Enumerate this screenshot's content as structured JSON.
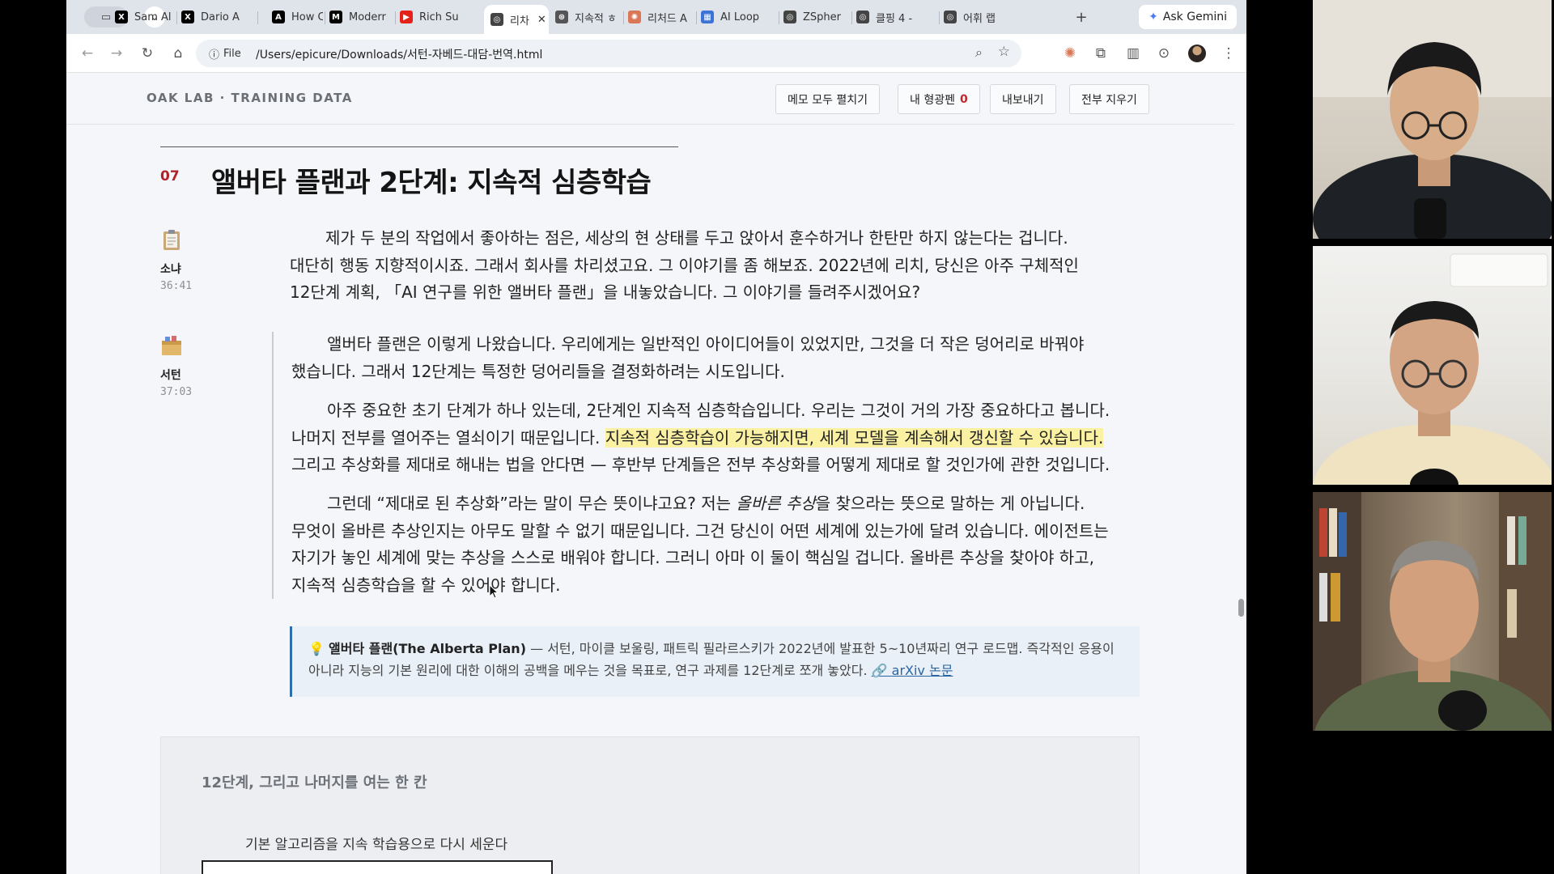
{
  "browser": {
    "tabs": [
      {
        "title": "Sam Al",
        "icon": "x-logo-icon",
        "color": "#000000"
      },
      {
        "title": "Dario A",
        "icon": "x-logo-icon",
        "color": "#000000"
      },
      {
        "title": "How Cl",
        "icon": "anthropic-logo-icon",
        "color": "#000000"
      },
      {
        "title": "Moderr",
        "icon": "medium-logo-icon",
        "color": "#000000"
      },
      {
        "title": "Rich Su",
        "icon": "youtube-icon",
        "color": "#e62117"
      },
      {
        "title": "리차",
        "icon": "globe-icon",
        "color": "#444444",
        "active": true
      },
      {
        "title": "지속적 ㅎ",
        "icon": "chatgpt-icon",
        "color": "#555555"
      },
      {
        "title": "리처드 A",
        "icon": "claude-icon",
        "color": "#d97757"
      },
      {
        "title": "AI Loop",
        "icon": "grid-icon",
        "color": "#3b74d6"
      },
      {
        "title": "ZSpher",
        "icon": "globe-icon",
        "color": "#444444"
      },
      {
        "title": "클핑 4 -",
        "icon": "globe-icon",
        "color": "#444444"
      },
      {
        "title": "어휘 랩",
        "icon": "globe-icon",
        "color": "#444444"
      }
    ],
    "ask_gemini": "Ask Gemini",
    "info_label": "File",
    "url": "/Users/epicure/Downloads/서턴-자베드-대담-번역.html"
  },
  "site": {
    "brand": "OAK LAB · TRAINING DATA",
    "buttons": {
      "expand_memos": "메모 모두 펼치기",
      "my_highlighter": "내 형광펜",
      "highlight_count": "0",
      "export": "내보내기",
      "clear_all": "전부 지우기"
    }
  },
  "section": {
    "number": "07",
    "title": "앨버타 플랜과 2단계: 지속적 심층학습",
    "speakers": [
      {
        "name": "소냐",
        "time": "36:41",
        "icon": "clipboard-icon"
      },
      {
        "name": "서턴",
        "time": "37:03",
        "icon": "box-icon"
      }
    ],
    "q_lines": [
      "제가 두 분의 작업에서 좋아하는 점은, 세상의 현 상태를 두고 앉아서 훈수하거나 한탄만 하지 않는다는 겁니다.",
      "대단히 행동 지향적이시죠. 그래서 회사를 차리셨고요. 그 이야기를 좀 해보죠. 2022년에 리치, 당신은 아주 구체적인",
      "12단계 계획, 「AI 연구를 위한 앨버타 플랜」을 내놓았습니다. 그 이야기를 들려주시겠어요?"
    ],
    "a1_lines": [
      "앨버타 플랜은 이렇게 나왔습니다. 우리에게는 일반적인 아이디어들이 있었지만, 그것을 더 작은 덩어리로 바꿔야",
      "했습니다. 그래서 12단계는 특정한 덩어리들을 결정화하려는 시도입니다."
    ],
    "a2_line1": "아주 중요한 초기 단계가 하나 있는데, 2단계인 지속적 심층학습입니다. 우리는 그것이 거의 가장 중요하다고 봅니다.",
    "a2_line2_pre": "나머지 전부를 열어주는 열쇠이기 때문입니다. ",
    "a2_line2_hl": "지속적 심층학습이 가능해지면, 세계 모델을 계속해서 갱신할 수 있습니다.",
    "a2_line3": "그리고 추상화를 제대로 해내는 법을 안다면 — 후반부 단계들은 전부 추상화를 어떻게 제대로 할 것인가에 관한 것입니다.",
    "a3_line1_pre": "그런데 “제대로 된 추상화”라는 말이 무슨 뜻이냐고요? 저는 ",
    "a3_line1_em": "올바른 추상",
    "a3_line1_post": "을 찾으라는 뜻으로 말하는 게 아닙니다.",
    "a3_lines": [
      "무엇이 올바른 추상인지는 아무도 말할 수 없기 때문입니다. 그건 당신이 어떤 세계에 있는가에 달려 있습니다. 에이전트는",
      "자기가 놓인 세계에 맞는 추상을 스스로 배워야 합니다. 그러니 아마 이 둘이 핵심일 겁니다. 올바른 추상을 찾아야 하고,",
      "지속적 심층학습을 할 수 있어야 합니다."
    ],
    "note": {
      "icon": "lightbulb-icon",
      "bold": "앨버타 플랜(The Alberta Plan)",
      "line1_rest": " — 서턴, 마이클 보울링, 패트릭 필라르스키가 2022년에 발표한 5~10년짜리 연구 로드맵. 즉각적인 응용이",
      "line2": "아니라 지능의 기본 원리에 대한 이해의 공백을 메우는 것을 목표로, 연구 과제를 12단계로 쪼개 놓았다. ",
      "link_icon": "link-icon",
      "link": "arXiv 논문"
    },
    "box": {
      "title": "12단계, 그리고 나머지를 여는 한 칸",
      "step_label": "기본 알고리즘을 지속 학습용으로 다시 세운다"
    }
  }
}
